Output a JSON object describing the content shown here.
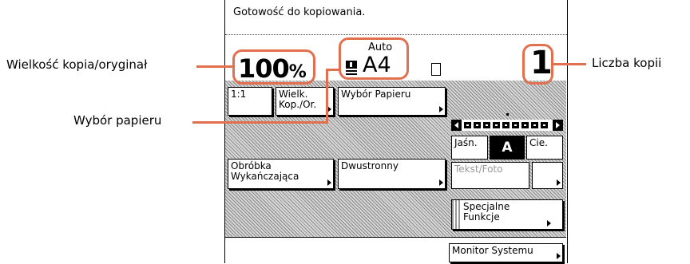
{
  "status_message": "Gotowość do kopiowania.",
  "ratio": {
    "value": "100",
    "unit": "%"
  },
  "paper": {
    "mode": "Auto",
    "size": "A4"
  },
  "copies": "1",
  "buttons": {
    "one_to_one": "1:1",
    "zoom_line1": "Wielk.",
    "zoom_line2": "Kop./Or.",
    "paper_select": "Wybór Papieru",
    "finishing_line1": "Obróbka",
    "finishing_line2": "Wykańczająca",
    "duplex": "Dwustronny",
    "text_photo": "Tekst/Foto",
    "special_line1": "Specjalne",
    "special_line2": "Funkcje",
    "monitor": "Monitor Systemu"
  },
  "density": {
    "lighter": "Jaśn.",
    "auto": "A",
    "darker": "Cie.",
    "level": 4,
    "steps": 9
  },
  "callouts": {
    "ratio": "Wielkość kopia/oryginał",
    "paper": "Wybór papieru",
    "copies": "Liczba kopii"
  },
  "colors": {
    "accent": "#e0704e"
  }
}
